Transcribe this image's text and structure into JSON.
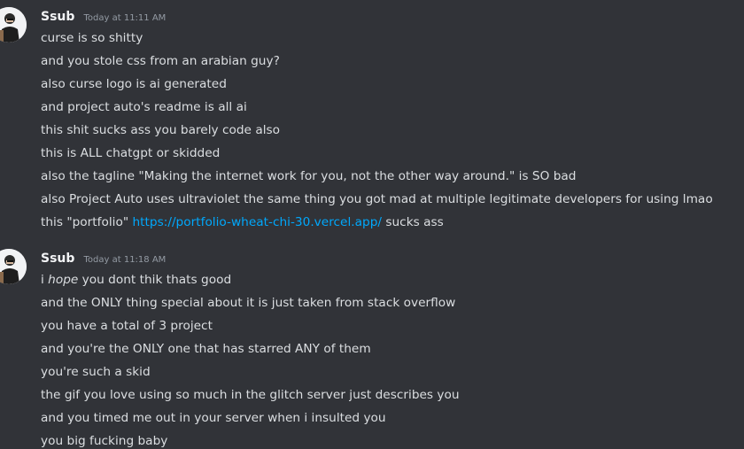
{
  "messages": [
    {
      "author": "Ssub",
      "timestamp": "Today at 11:11 AM",
      "lines": [
        "curse is so shitty",
        "and you stole css from an arabian guy?",
        "also curse logo is ai generated",
        "and project auto's readme is all ai",
        "this shit sucks ass you barely code also",
        "this is ALL chatgpt or skidded",
        "also the tagline \"Making the internet work for you, not the other way around.\" is SO bad",
        "also Project Auto uses ultraviolet the same thing you got mad at multiple legitimate developers for using lmao"
      ],
      "portfolio_line": {
        "prefix": "this \"portfolio\" ",
        "link": "https://portfolio-wheat-chi-30.vercel.app/",
        "suffix": " sucks ass"
      }
    },
    {
      "author": "Ssub",
      "timestamp": "Today at 11:18 AM",
      "hope_line": {
        "prefix": "i ",
        "emphasis": "hope",
        "suffix": " you dont thik thats good"
      },
      "lines": [
        "and the ONLY thing special about it is just taken from stack overflow",
        "you have a total of 3 project",
        "and you're the ONLY one that has starred ANY of them",
        "you're such a skid",
        "the gif you love using so much in the glitch server just describes you",
        "and you timed me out in your server when i insulted you",
        "you big fucking baby"
      ]
    }
  ],
  "colors": {
    "background": "#313338",
    "text": "#dbdee1",
    "username": "#f2f3f5",
    "timestamp": "#949ba4",
    "link": "#00a8fc"
  }
}
